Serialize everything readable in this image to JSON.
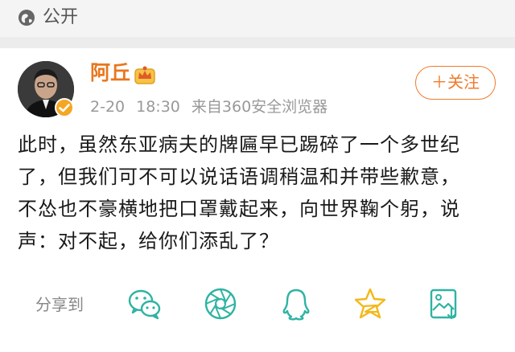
{
  "header": {
    "visibility_label": "公开",
    "visibility_icon": "globe-icon"
  },
  "post": {
    "author": "阿丘",
    "date": "2-20",
    "time": "18:30",
    "source": "来自360安全浏览器",
    "follow_label": "＋关注",
    "content_lines": [
      "此时，虽然东亚病夫的牌匾早已踢碎了一个多世纪",
      "了，但我们可不可以说话语调稍温和并带些歉意，",
      "不怂也不豪横地把口罩戴起来，向世界鞠个躬，说",
      "声：对不起，给你们添乱了？"
    ]
  },
  "share": {
    "label": "分享到",
    "targets": [
      "wechat-icon",
      "moments-icon",
      "qq-icon",
      "qzone-icon",
      "save-image-icon"
    ]
  },
  "colors": {
    "accent": "#f07a2b",
    "username": "#e8771e",
    "share_icons": "#2fb3a3",
    "qzone_star": "#f3b81b"
  }
}
